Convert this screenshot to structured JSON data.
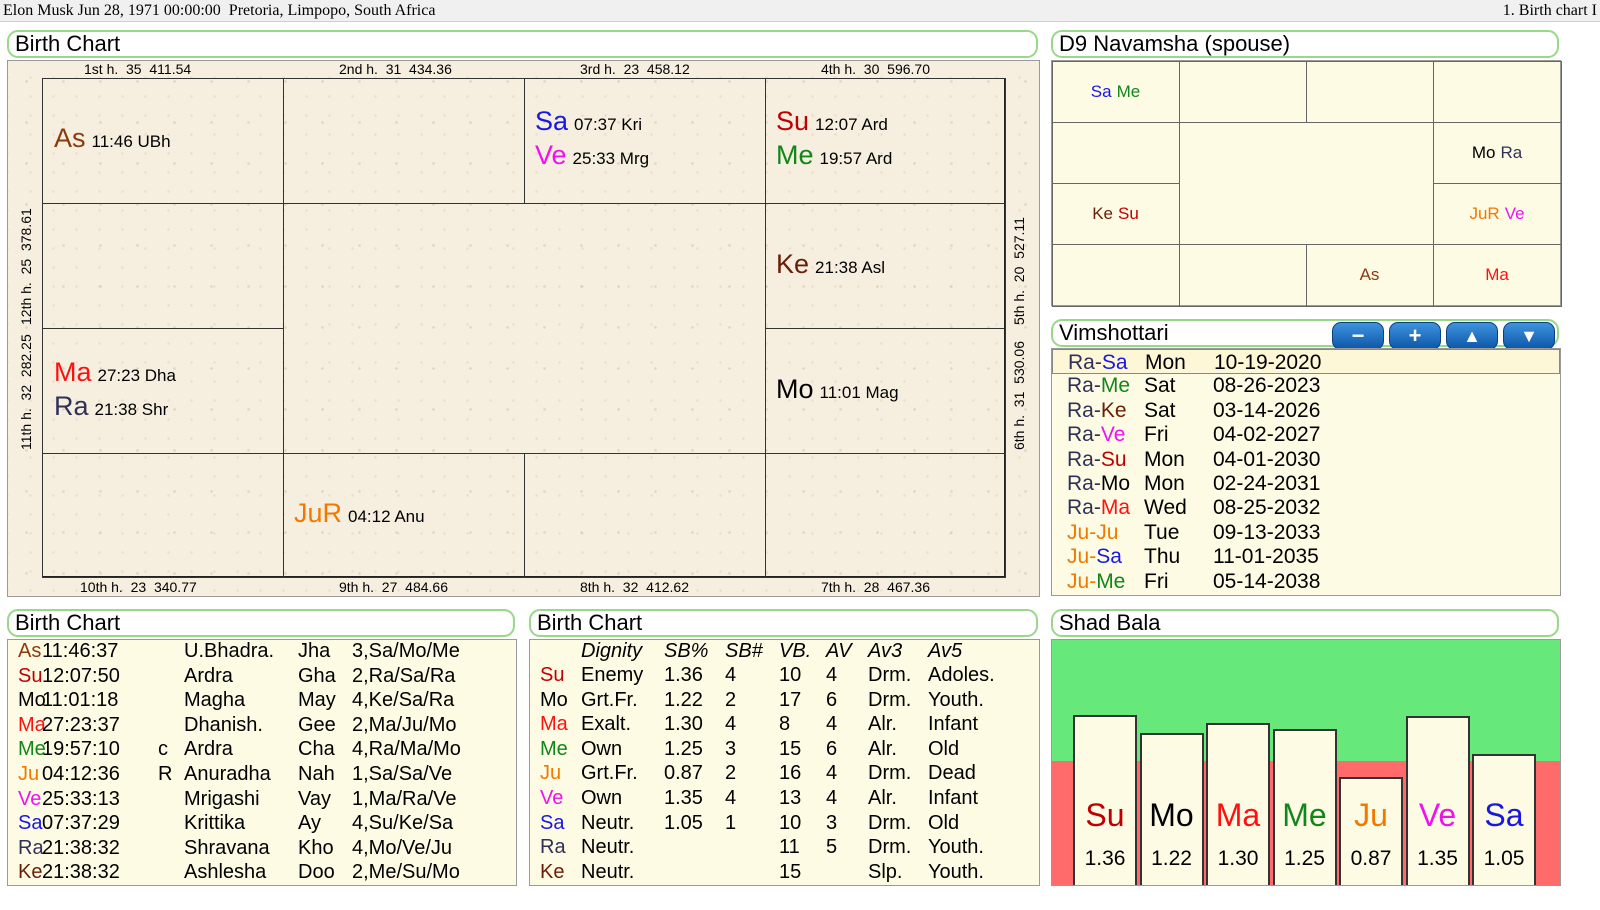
{
  "top_bar": {
    "left": "Elon Musk Jun 28, 1971 00:00:00  Pretoria, Limpopo, South Africa",
    "right": "1. Birth chart I"
  },
  "colors": {
    "As": "#8b3a0c",
    "Su": "#c00000",
    "Mo": "#000000",
    "Ma": "#ff1010",
    "Me": "#12861a",
    "Ju": "#f07a00",
    "Ve": "#f010f0",
    "Sa": "#1818e0",
    "Ra": "#303058",
    "Ke": "#6a1e08",
    "JuR": "#f07a00"
  },
  "birth_chart": {
    "title": "Birth Chart",
    "top_labels": [
      "1st h.  35  411.54",
      "2nd h.  31  434.36",
      "3rd h.  23  458.12",
      "4th h.  30  596.70"
    ],
    "bottom_labels": [
      "10th h.  23  340.77",
      "9th h.  27  484.66",
      "8th h.  32  412.62",
      "7th h.  28  467.36"
    ],
    "left_labels": [
      "12th h.  25  378.61",
      "11th h.  32  282.25"
    ],
    "right_labels": [
      "5th h.  20  527.11",
      "6th h.  31  530.06"
    ],
    "planets": [
      {
        "abbr": "As",
        "deg": "11:46 UBh"
      },
      {
        "abbr": "Sa",
        "deg": "07:37 Kri"
      },
      {
        "abbr": "Ve",
        "deg": "25:33 Mrg"
      },
      {
        "abbr": "Su",
        "deg": "12:07 Ard"
      },
      {
        "abbr": "Me",
        "deg": "19:57 Ard"
      },
      {
        "abbr": "Ke",
        "deg": "21:38 Asl"
      },
      {
        "abbr": "Ma",
        "deg": "27:23 Dha"
      },
      {
        "abbr": "Ra",
        "deg": "21:38 Shr"
      },
      {
        "abbr": "Mo",
        "deg": "11:01 Mag"
      },
      {
        "abbr": "JuR",
        "deg": "04:12 Anu"
      }
    ]
  },
  "navamsha": {
    "title": "D9 Navamsha  (spouse)",
    "cells": [
      [
        "Sa",
        "Me"
      ],
      [
        "Mo",
        "Ra"
      ],
      [
        "Ke",
        "Su"
      ],
      [
        "JuR",
        "Ve"
      ],
      [
        "As"
      ],
      [
        "Ma"
      ]
    ]
  },
  "vimshottari": {
    "title": "Vimshottari",
    "buttons": [
      "−",
      "+",
      "▲",
      "▼"
    ],
    "rows": [
      {
        "maha": "Ra",
        "antar": "Sa",
        "day": "Mon",
        "date": "10-19-2020"
      },
      {
        "maha": "Ra",
        "antar": "Me",
        "day": "Sat",
        "date": "08-26-2023"
      },
      {
        "maha": "Ra",
        "antar": "Ke",
        "day": "Sat",
        "date": "03-14-2026"
      },
      {
        "maha": "Ra",
        "antar": "Ve",
        "day": "Fri",
        "date": "04-02-2027"
      },
      {
        "maha": "Ra",
        "antar": "Su",
        "day": "Mon",
        "date": "04-01-2030"
      },
      {
        "maha": "Ra",
        "antar": "Mo",
        "day": "Mon",
        "date": "02-24-2031"
      },
      {
        "maha": "Ra",
        "antar": "Ma",
        "day": "Wed",
        "date": "08-25-2032"
      },
      {
        "maha": "Ju",
        "antar": "Ju",
        "day": "Tue",
        "date": "09-13-2033"
      },
      {
        "maha": "Ju",
        "antar": "Sa",
        "day": "Thu",
        "date": "11-01-2035"
      },
      {
        "maha": "Ju",
        "antar": "Me",
        "day": "Fri",
        "date": "05-14-2038"
      }
    ]
  },
  "positions": {
    "title": "Birth Chart",
    "rows": [
      {
        "p": "As",
        "deg": "11:46:37",
        "flag": "",
        "nak": "U.Bhadra.",
        "syl": "Jha",
        "pada": "3,Sa/Mo/Me"
      },
      {
        "p": "Su",
        "deg": "12:07:50",
        "flag": "",
        "nak": "Ardra",
        "syl": "Gha",
        "pada": "2,Ra/Sa/Ra"
      },
      {
        "p": "Mo",
        "deg": "11:01:18",
        "flag": "",
        "nak": "Magha",
        "syl": "May",
        "pada": "4,Ke/Sa/Ra"
      },
      {
        "p": "Ma",
        "deg": "27:23:37",
        "flag": "",
        "nak": "Dhanish.",
        "syl": "Gee",
        "pada": "2,Ma/Ju/Mo"
      },
      {
        "p": "Me",
        "deg": "19:57:10",
        "flag": "c",
        "nak": "Ardra",
        "syl": "Cha",
        "pada": "4,Ra/Ma/Mo"
      },
      {
        "p": "Ju",
        "deg": "04:12:36",
        "flag": "R",
        "nak": "Anuradha",
        "syl": "Nah",
        "pada": "1,Sa/Sa/Ve"
      },
      {
        "p": "Ve",
        "deg": "25:33:13",
        "flag": "",
        "nak": "Mrigashi",
        "syl": "Vay",
        "pada": "1,Ma/Ra/Ve"
      },
      {
        "p": "Sa",
        "deg": "07:37:29",
        "flag": "",
        "nak": "Krittika",
        "syl": "Ay",
        "pada": "4,Su/Ke/Sa"
      },
      {
        "p": "Ra",
        "deg": "21:38:32",
        "flag": "",
        "nak": "Shravana",
        "syl": "Kho",
        "pada": "4,Mo/Ve/Ju"
      },
      {
        "p": "Ke",
        "deg": "21:38:32",
        "flag": "",
        "nak": "Ashlesha",
        "syl": "Doo",
        "pada": "2,Me/Su/Mo"
      }
    ]
  },
  "dignity": {
    "title": "Birth Chart",
    "headers": [
      "Dignity",
      "SB%",
      "SB#",
      "VB.",
      "AV",
      "Av3",
      "Av5"
    ],
    "rows": [
      {
        "p": "Su",
        "dignity": "Enemy",
        "sbp": "1.36",
        "sbn": "4",
        "vb": "10",
        "av": "4",
        "av3": "Drm.",
        "av5": "Adoles."
      },
      {
        "p": "Mo",
        "dignity": "Grt.Fr.",
        "sbp": "1.22",
        "sbn": "2",
        "vb": "17",
        "av": "6",
        "av3": "Drm.",
        "av5": "Youth."
      },
      {
        "p": "Ma",
        "dignity": "Exalt.",
        "sbp": "1.30",
        "sbn": "4",
        "vb": "8",
        "av": "4",
        "av3": "Alr.",
        "av5": "Infant"
      },
      {
        "p": "Me",
        "dignity": "Own",
        "sbp": "1.25",
        "sbn": "3",
        "vb": "15",
        "av": "6",
        "av3": "Alr.",
        "av5": "Old"
      },
      {
        "p": "Ju",
        "dignity": "Grt.Fr.",
        "sbp": "0.87",
        "sbn": "2",
        "vb": "16",
        "av": "4",
        "av3": "Drm.",
        "av5": "Dead"
      },
      {
        "p": "Ve",
        "dignity": "Own",
        "sbp": "1.35",
        "sbn": "4",
        "vb": "13",
        "av": "4",
        "av3": "Alr.",
        "av5": "Infant"
      },
      {
        "p": "Sa",
        "dignity": "Neutr.",
        "sbp": "1.05",
        "sbn": "1",
        "vb": "10",
        "av": "3",
        "av3": "Drm.",
        "av5": "Old"
      },
      {
        "p": "Ra",
        "dignity": "Neutr.",
        "sbp": "",
        "sbn": "",
        "vb": "11",
        "av": "5",
        "av3": "Drm.",
        "av5": "Youth."
      },
      {
        "p": "Ke",
        "dignity": "Neutr.",
        "sbp": "",
        "sbn": "",
        "vb": "15",
        "av": "",
        "av3": "Slp.",
        "av5": "Youth."
      }
    ]
  },
  "shad_bala": {
    "title": "Shad Bala",
    "bars": [
      {
        "p": "Su",
        "value": "1.36"
      },
      {
        "p": "Mo",
        "value": "1.22"
      },
      {
        "p": "Ma",
        "value": "1.30"
      },
      {
        "p": "Me",
        "value": "1.25"
      },
      {
        "p": "Ju",
        "value": "0.87"
      },
      {
        "p": "Ve",
        "value": "1.35"
      },
      {
        "p": "Sa",
        "value": "1.05"
      }
    ]
  },
  "chart_data": {
    "type": "bar",
    "title": "Shad Bala",
    "categories": [
      "Su",
      "Mo",
      "Ma",
      "Me",
      "Ju",
      "Ve",
      "Sa"
    ],
    "values": [
      1.36,
      1.22,
      1.3,
      1.25,
      0.87,
      1.35,
      1.05
    ],
    "threshold": 1.0,
    "background_colors": {
      "above": "#66e87a",
      "below": "#ff6a6a"
    }
  }
}
